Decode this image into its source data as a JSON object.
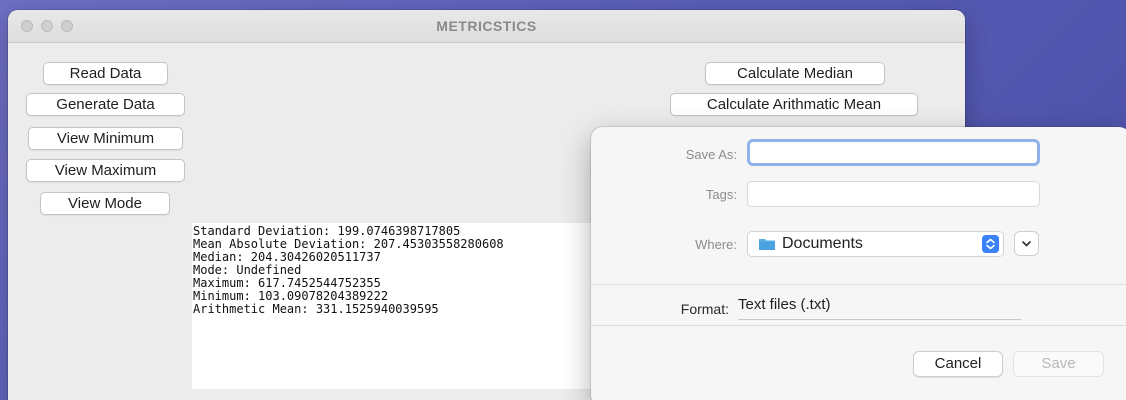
{
  "window": {
    "title": "METRICSTICS"
  },
  "left_buttons": {
    "read_data": "Read Data",
    "generate_data": "Generate Data",
    "view_minimum": "View Minimum",
    "view_maximum": "View Maximum",
    "view_mode": "View Mode"
  },
  "right_buttons": {
    "calculate_median": "Calculate Median",
    "calculate_arithmetic_mean": "Calculate Arithmatic Mean"
  },
  "output": {
    "lines": [
      "Standard Deviation: 199.0746398717805",
      "Mean Absolute Deviation: 207.45303558280608",
      "Median: 204.30426020511737",
      "Mode: Undefined",
      "Maximum: 617.7452544752355",
      "Minimum: 103.09078204389222",
      "Arithmetic Mean: 331.1525940039595"
    ]
  },
  "save_dialog": {
    "save_as_label": "Save As:",
    "save_as_value": "",
    "tags_label": "Tags:",
    "where_label": "Where:",
    "where_value": "Documents",
    "format_label": "Format:",
    "format_value": "Text files (.txt)",
    "cancel_label": "Cancel",
    "save_label": "Save"
  },
  "icons": {
    "folder": "folder-icon",
    "stepper": "up-down-chevron-icon",
    "expand": "chevron-down-icon"
  },
  "colors": {
    "accent": "#3a82f7",
    "focus_ring": "#8fb3e8",
    "folder": "#5eb2ea"
  }
}
